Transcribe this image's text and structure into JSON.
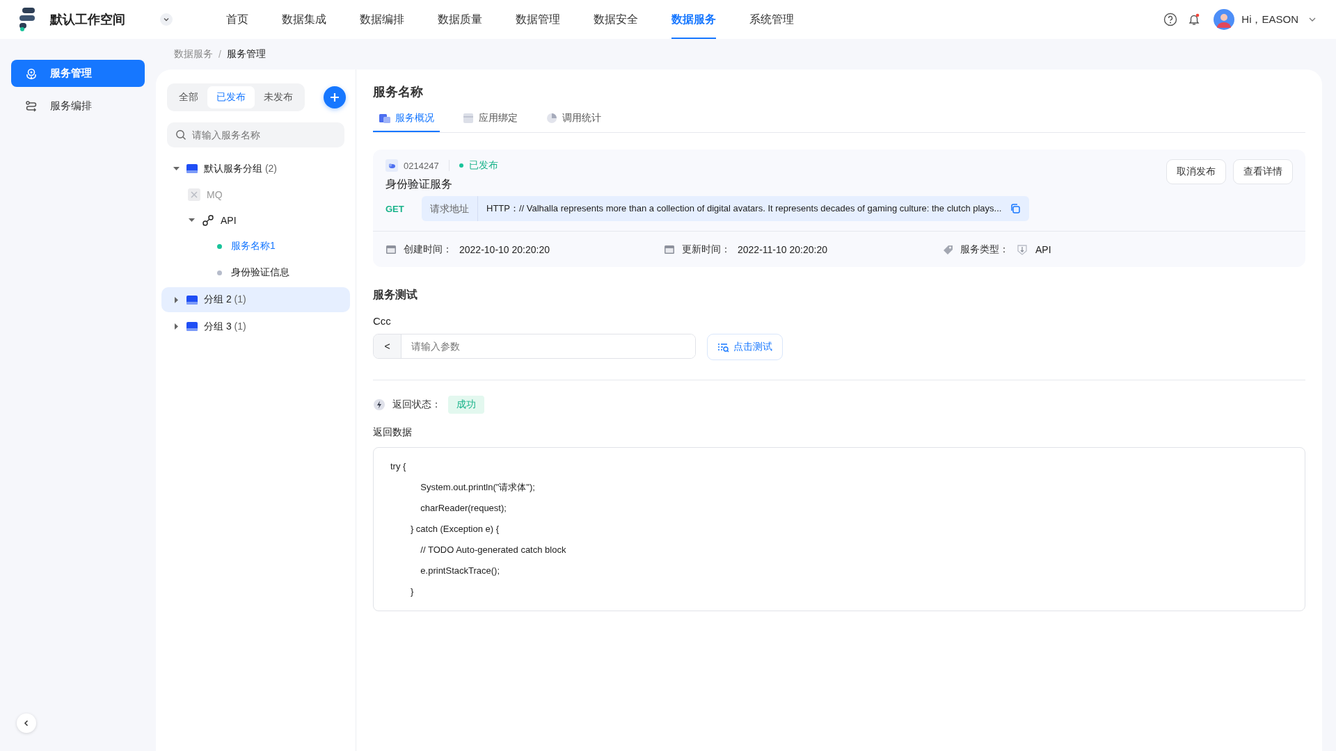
{
  "header": {
    "workspace": "默认工作空间",
    "nav": [
      {
        "label": "首页",
        "selected": false
      },
      {
        "label": "数据集成",
        "selected": false
      },
      {
        "label": "数据编排",
        "selected": false
      },
      {
        "label": "数据质量",
        "selected": false
      },
      {
        "label": "数据管理",
        "selected": false
      },
      {
        "label": "数据安全",
        "selected": false
      },
      {
        "label": "数据服务",
        "selected": true
      },
      {
        "label": "系统管理",
        "selected": false
      }
    ],
    "user": "Hi，EASON"
  },
  "sidebar": {
    "items": [
      {
        "label": "服务管理",
        "kind": "manage",
        "selected": true
      },
      {
        "label": "服务编排",
        "kind": "flow",
        "selected": false
      }
    ]
  },
  "breadcrumb": {
    "items": [
      "数据服务",
      "服务管理"
    ],
    "separator": "/"
  },
  "tree_panel": {
    "filters": [
      {
        "label": "全部",
        "selected": false
      },
      {
        "label": "已发布",
        "selected": true
      },
      {
        "label": "未发布",
        "selected": false
      }
    ],
    "search": {
      "placeholder": "请输入服务名称"
    },
    "tree": [
      {
        "kind": "group",
        "label": "默认服务分组",
        "count": "(2)",
        "expanded": true,
        "selected": false,
        "children": [
          {
            "kind": "mq",
            "label": "MQ",
            "disabled": true,
            "selected": false
          },
          {
            "kind": "api",
            "label": "API",
            "expanded": true,
            "selected": false,
            "children": [
              {
                "kind": "service",
                "label": "服务名称1",
                "color": "#19c39a",
                "selected": true
              },
              {
                "kind": "service",
                "label": "身份验证信息",
                "color": "#b6bccb",
                "selected": false
              }
            ]
          }
        ]
      },
      {
        "kind": "group",
        "label": "分组 2",
        "count": "(1)",
        "expanded": false,
        "selected": true
      },
      {
        "kind": "group",
        "label": "分组 3",
        "count": "(1)",
        "expanded": false,
        "selected": false
      }
    ]
  },
  "detail": {
    "title": "服务名称",
    "tabs": [
      {
        "label": "服务概况",
        "kind": "overview",
        "selected": true
      },
      {
        "label": "应用绑定",
        "kind": "binding",
        "selected": false
      },
      {
        "label": "调用统计",
        "kind": "stats",
        "selected": false
      }
    ],
    "card": {
      "id": "0214247",
      "status": "已发布",
      "name": "身份验证服务",
      "buttons": [
        "取消发布",
        "查看详情"
      ],
      "method": "GET",
      "url_label": "请求地址",
      "url": "HTTP：// Valhalla represents more than a collection of digital avatars. It represents decades of gaming culture: the clutch plays...",
      "meta": [
        {
          "label": "创建时间：",
          "value": "2022-10-10  20:20:20",
          "kind": "date"
        },
        {
          "label": "更新时间：",
          "value": "2022-11-10  20:20:20",
          "kind": "date"
        },
        {
          "label": "服务类型：",
          "value": "API",
          "kind": "type"
        }
      ]
    },
    "test": {
      "title": "服务测试",
      "param_label": "Ccc",
      "prefix": "<",
      "placeholder": "请输入参数",
      "button": "点击测试"
    },
    "result": {
      "status_label": "返回状态：",
      "status": "成功",
      "data_label": "返回数据",
      "code": [
        "try {",
        "            System.out.println(\"请求体\");",
        "            charReader(request);",
        "        } catch (Exception e) {",
        "            // TODO Auto-generated catch block",
        "            e.printStackTrace();",
        "        }"
      ]
    }
  }
}
